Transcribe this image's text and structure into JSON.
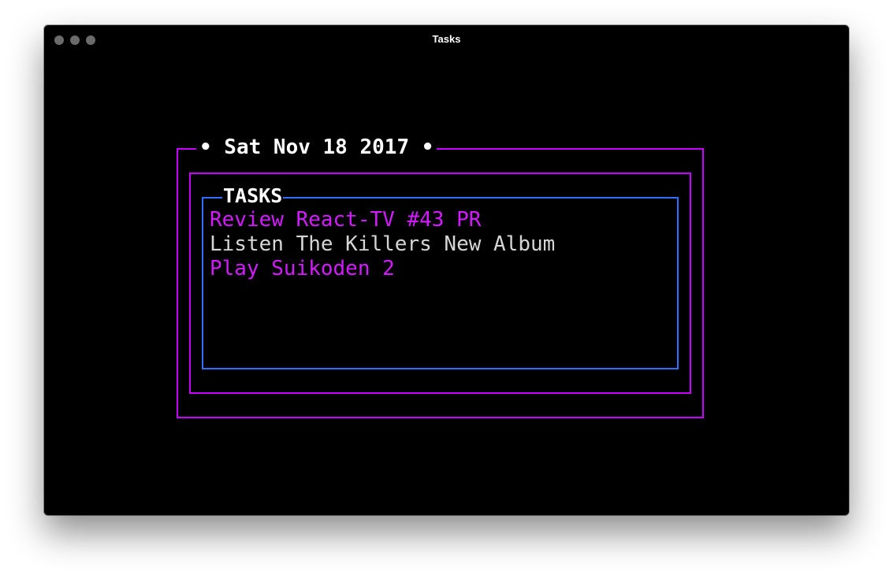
{
  "window": {
    "title": "Tasks"
  },
  "colors": {
    "background": "#000000",
    "outer_border": "#c700ff",
    "inner_border": "#2f6fff",
    "highlight_text": "#d21cff",
    "normal_text": "#d6d6d6",
    "label_text": "#ffffff"
  },
  "header": {
    "date_label": "• Sat Nov 18 2017 •"
  },
  "tasks_panel": {
    "label": "TASKS",
    "items": [
      {
        "text": "Review React-TV #43 PR",
        "highlighted": true
      },
      {
        "text": "Listen The Killers New Album",
        "highlighted": false
      },
      {
        "text": "Play Suikoden 2",
        "highlighted": true
      }
    ]
  }
}
